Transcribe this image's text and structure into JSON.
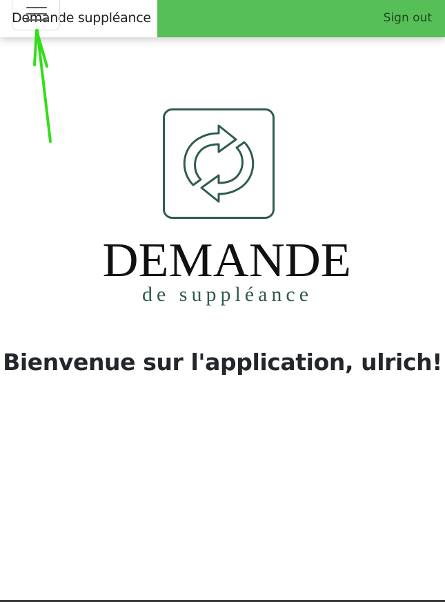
{
  "colors": {
    "navbar_green": "#57bf57",
    "signout_text": "#1d4a1d",
    "logo_green": "#2f5d4a",
    "annotation_arrow": "#33dd1a"
  },
  "header": {
    "brand_title": "Demande suppléance",
    "menu_icon": "hamburger-menu-icon",
    "signout_label": "Sign out"
  },
  "logo": {
    "icon": "refresh-arrows-icon",
    "word": "DEMANDE",
    "subtitle": "de suppléance"
  },
  "main": {
    "welcome_text": "Bienvenue sur l'application, ulrich!"
  }
}
